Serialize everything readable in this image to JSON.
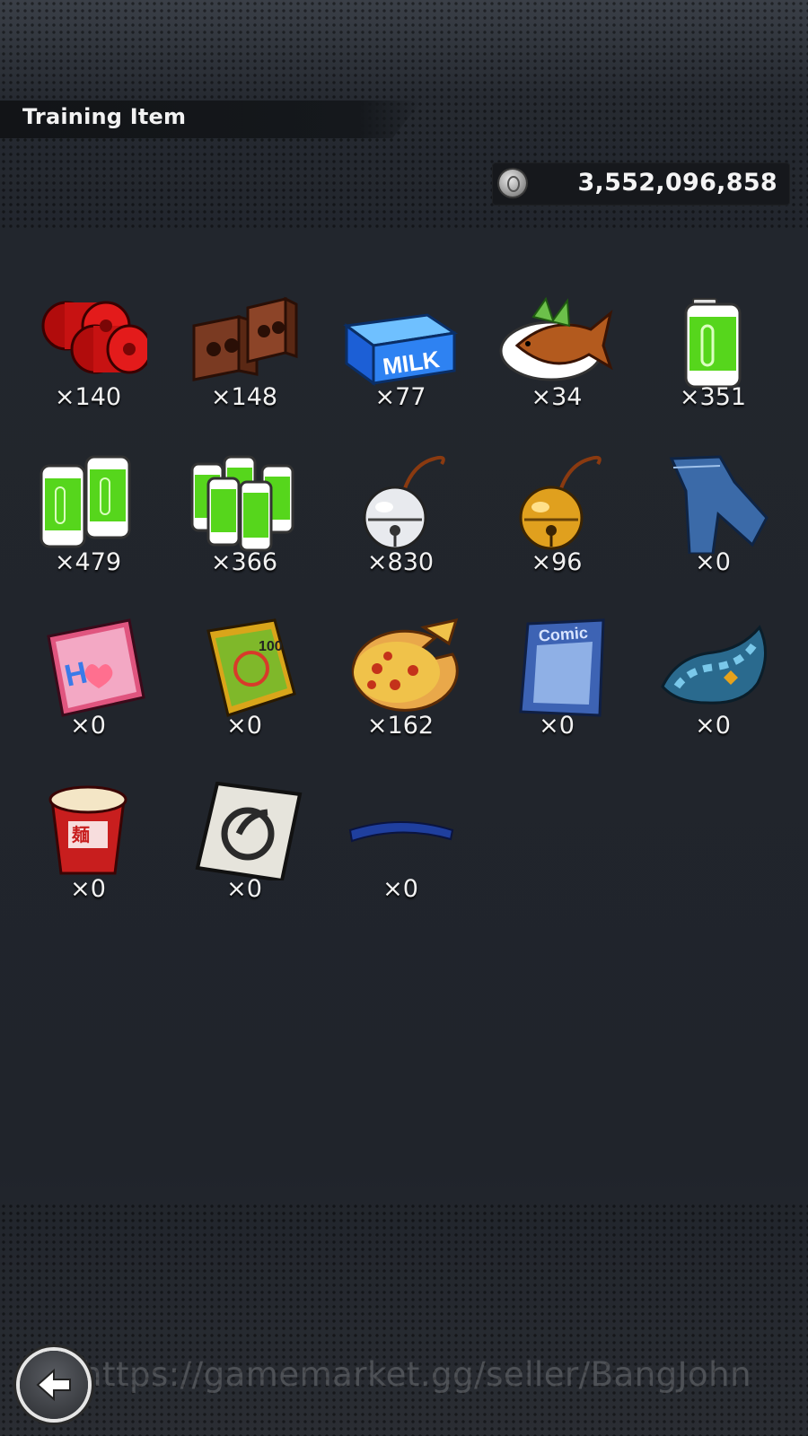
{
  "header": {
    "title": "Training Item"
  },
  "currency": {
    "icon": "zeni-coin-icon",
    "amount": "3,552,096,858"
  },
  "items": [
    {
      "icon": "red-weights-icon",
      "count": "×140"
    },
    {
      "icon": "brick-weights-icon",
      "count": "×148"
    },
    {
      "icon": "milk-carton-icon",
      "count": "×77"
    },
    {
      "icon": "grilled-fish-icon",
      "count": "×34"
    },
    {
      "icon": "battery-icon",
      "count": "×351"
    },
    {
      "icon": "battery-pair-icon",
      "count": "×479"
    },
    {
      "icon": "battery-pack-icon",
      "count": "×366"
    },
    {
      "icon": "silver-bell-icon",
      "count": "×830"
    },
    {
      "icon": "gold-bell-icon",
      "count": "×96"
    },
    {
      "icon": "jeans-icon",
      "count": "×0"
    },
    {
      "icon": "pink-book-icon",
      "count": "×0"
    },
    {
      "icon": "manga-book-icon",
      "count": "×0"
    },
    {
      "icon": "pizza-icon",
      "count": "×162"
    },
    {
      "icon": "comic-magazine-icon",
      "count": "×0"
    },
    {
      "icon": "shoe-insole-icon",
      "count": "×0"
    },
    {
      "icon": "cup-noodle-icon",
      "count": "×0"
    },
    {
      "icon": "symbol-card-icon",
      "count": "×0"
    },
    {
      "icon": "blue-headband-icon",
      "count": "×0"
    }
  ],
  "watermark": "https://gamemarket.gg/seller/BangJohn",
  "back_button": {
    "icon": "back-arrow-icon"
  }
}
